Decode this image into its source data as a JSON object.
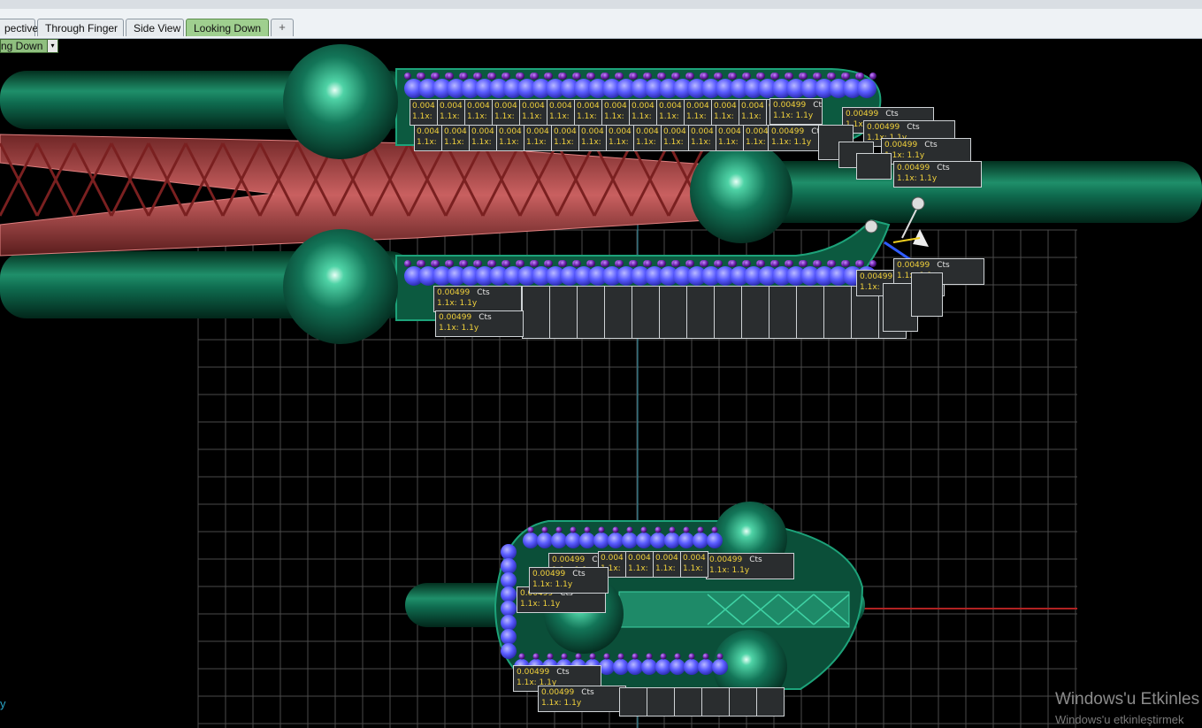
{
  "viewport_tabs": [
    {
      "label": "pective",
      "active": false
    },
    {
      "label": "Through Finger",
      "active": false
    },
    {
      "label": "Side View",
      "active": false
    },
    {
      "label": "Looking Down",
      "active": true
    }
  ],
  "tab_add_symbol": "+",
  "view_dropdown": {
    "label": "ng Down",
    "arrow": "▾"
  },
  "stone_label": {
    "weight": "0.00499",
    "unit": "Cts",
    "scale": "1.1x: 1.1y"
  },
  "truncated_labels": {
    "weight": "0.004",
    "scale": "1.1x:"
  },
  "axis_letter": "y",
  "watermark": {
    "title": "Windows'u Etkinles",
    "subtitle": "Windows'u etkinleştirmek"
  },
  "colors": {
    "background": "#000000",
    "grid": "#4a4a4a",
    "shank_green": "#0f6b4f",
    "gallery_red": "#c05050",
    "stone_blue": "#5a5cff",
    "prong_purple": "#6a1fa8",
    "label_text": "#f2d23c",
    "active_tab": "#9fcf8f"
  },
  "icons": [
    "gumball-manipulator-icon"
  ]
}
